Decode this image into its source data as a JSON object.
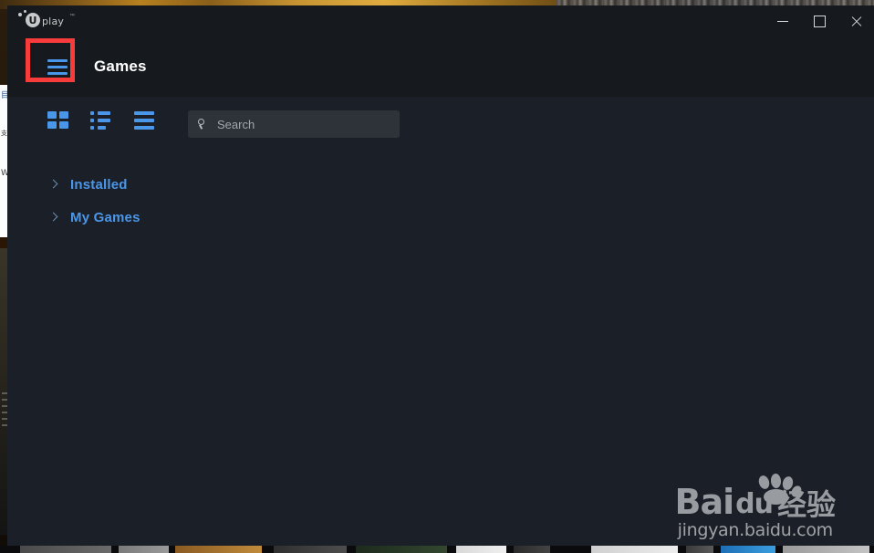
{
  "window": {
    "app_name": "Uplay",
    "logo_letter": "U",
    "logo_word": "play",
    "logo_tm": "™",
    "controls": {
      "minimize": "minimize-button",
      "maximize": "maximize-button",
      "close": "close-button"
    }
  },
  "header": {
    "menu_icon": "hamburger-menu-icon",
    "title": "Games"
  },
  "annotation": {
    "color": "#f83b3b",
    "target": "hamburger-menu-button"
  },
  "toolbar": {
    "views": [
      {
        "name": "grid-view",
        "icon": "grid-icon",
        "selected": true
      },
      {
        "name": "list-view",
        "icon": "list-icon",
        "selected": false
      },
      {
        "name": "detail-view",
        "icon": "rows-icon",
        "selected": false
      }
    ],
    "accent_color": "#4a96e8"
  },
  "search": {
    "icon": "search-icon",
    "value": "",
    "placeholder": "Search"
  },
  "sections": [
    {
      "label": "Installed",
      "expanded": false,
      "chevron": "chevron-right-icon"
    },
    {
      "label": "My Games",
      "expanded": false,
      "chevron": "chevron-right-icon"
    }
  ],
  "watermark": {
    "bai": "Bai",
    "du": "du",
    "chinese": "经验",
    "url": "jingyan.baidu.com",
    "logo": "baidu-paw-icon"
  },
  "colors": {
    "titlebar": "#16191d",
    "content": "#1b2028",
    "search_field": "#2d3339",
    "accent_blue": "#4a96e8",
    "title_text": "#ffffff",
    "annotation_red": "#f83b3b"
  }
}
